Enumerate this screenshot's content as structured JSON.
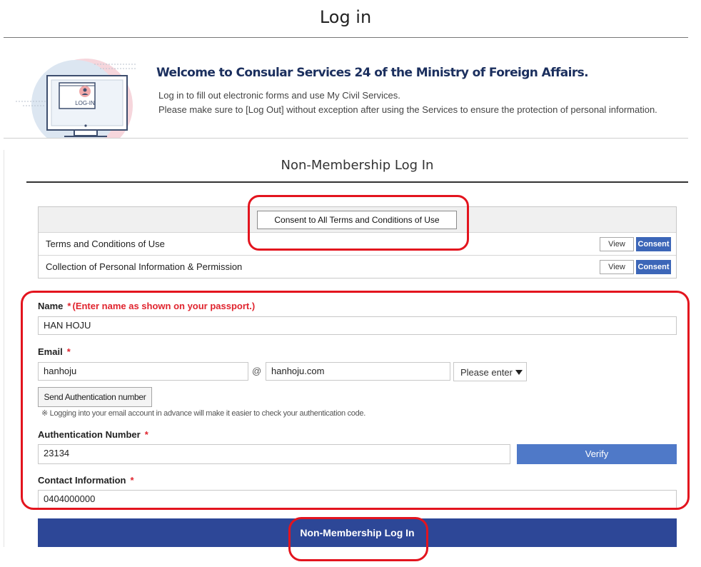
{
  "page": {
    "title": "Log in"
  },
  "banner": {
    "illustration_text": "LOG-IN",
    "welcome": "Welcome to Consular Services 24 of the Ministry of Foreign Affairs.",
    "line1": "Log in to fill out electronic forms and use My Civil Services.",
    "line2": "Please make sure to [Log Out] without exception after using the Services to ensure the protection of personal information."
  },
  "section": {
    "title": "Non-Membership Log In"
  },
  "terms": {
    "consent_all_label": "Consent to All Terms and Conditions of Use",
    "rows": [
      {
        "label": "Terms and Conditions of Use",
        "view_label": "View",
        "consent_label": "Consent"
      },
      {
        "label": "Collection of Personal Information & Permission",
        "view_label": "View",
        "consent_label": "Consent"
      }
    ]
  },
  "form": {
    "name": {
      "label": "Name",
      "required_mark": "*",
      "note": "(Enter name as shown on your passport.)",
      "value": "HAN HOJU"
    },
    "email": {
      "label": "Email",
      "required_mark": "*",
      "local_value": "hanhoju",
      "at_symbol": "@",
      "domain_value": "hanhoju.com",
      "domain_select": "Please enter",
      "send_auth_label": "Send Authentication number",
      "note": "※ Logging into your email account in advance will make it easier to check your authentication code."
    },
    "auth": {
      "label": "Authentication Number",
      "required_mark": "*",
      "value": "23134",
      "verify_label": "Verify"
    },
    "contact": {
      "label": "Contact Information",
      "required_mark": "*",
      "value": "0404000000"
    },
    "submit_label": "Non-Membership Log In"
  },
  "colors": {
    "primary_button": "#2d4797",
    "verify_button": "#4f79c8",
    "consent_button": "#3c66b8",
    "required": "#e0242e",
    "annotation": "#e3141e"
  }
}
